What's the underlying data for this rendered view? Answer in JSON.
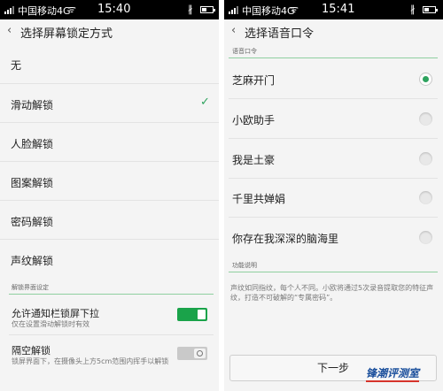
{
  "colors": {
    "accent": "#2ea35e",
    "toggle_on": "#1aa34a",
    "watermark": "#1a4f9c",
    "watermark_underline": "#d6332b"
  },
  "left_screen": {
    "status": {
      "carrier": "中国移动4G",
      "time": "15:40",
      "wifi_icon": "wifi-icon",
      "bluetooth_icon": "bluetooth-icon",
      "battery_icon": "battery-icon"
    },
    "title": "选择屏幕锁定方式",
    "lock_options": [
      {
        "label": "无",
        "selected": false
      },
      {
        "label": "滑动解锁",
        "selected": true
      },
      {
        "label": "人脸解锁",
        "selected": false
      },
      {
        "label": "图案解锁",
        "selected": false
      },
      {
        "label": "密码解锁",
        "selected": false
      },
      {
        "label": "声纹解锁",
        "selected": false
      }
    ],
    "section_title": "解锁界面设定",
    "toggles": [
      {
        "label": "允许通知栏锁屏下拉",
        "sub": "仅在设置滑动解锁时有效",
        "on": true
      },
      {
        "label": "隔空解锁",
        "sub": "锁屏界面下，在摄像头上方5cm范围内挥手以解锁",
        "on": false
      }
    ]
  },
  "right_screen": {
    "status": {
      "carrier": "中国移动4G",
      "time": "15:41",
      "wifi_icon": "wifi-icon",
      "bluetooth_icon": "bluetooth-icon",
      "battery_icon": "battery-icon"
    },
    "title": "选择语音口令",
    "section_title": "语音口令",
    "phrases": [
      {
        "label": "芝麻开门",
        "selected": true
      },
      {
        "label": "小欧助手",
        "selected": false
      },
      {
        "label": "我是土豪",
        "selected": false
      },
      {
        "label": "千里共婵娟",
        "selected": false
      },
      {
        "label": "你存在我深深的脑海里",
        "selected": false
      }
    ],
    "func_title": "功能说明",
    "description": "声纹如同指纹，每个人不同。小欧将通过5次录音提取您的特征声纹，打造不可破解的“专属密码”。",
    "next_button": "下一步",
    "watermark": "锋潮评测室"
  }
}
